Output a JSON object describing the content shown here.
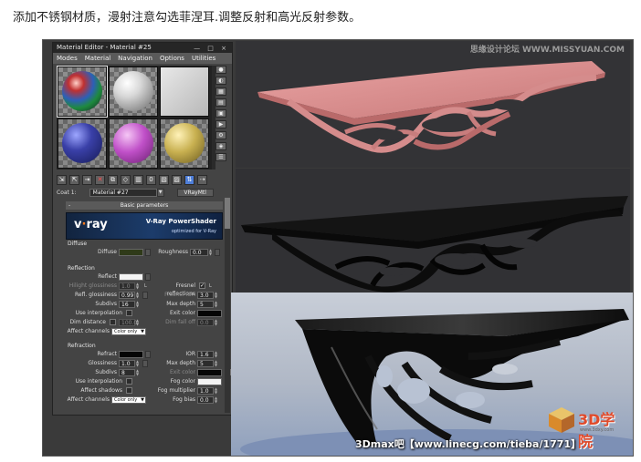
{
  "heading": "添加不锈钢材质，漫射注意勾选菲涅耳.调整反射和高光反射参数。",
  "material_editor": {
    "title": "Material Editor - Material #25",
    "window_controls": "— □ ×",
    "menu": [
      "Modes",
      "Material",
      "Navigation",
      "Options",
      "Utilities"
    ],
    "slot_count": 6,
    "coat_label": "Coat 1:",
    "material_name": "Material #27",
    "material_type": "VRayMtl",
    "rollout_title": "Basic parameters",
    "rollout_sign": "-"
  },
  "vray_banner": {
    "logo": "v·ray",
    "product": "V-Ray PowerShader",
    "tagline": "optimized for V-Ray"
  },
  "diffuse": {
    "section": "Diffuse",
    "diffuse_label": "Diffuse",
    "roughness_label": "Roughness",
    "roughness_value": "0.0"
  },
  "reflection": {
    "section": "Reflection",
    "reflect_label": "Reflect",
    "hilight_label": "Hilight glossiness",
    "hilight_value": "1.0",
    "lock": "L",
    "fresnel_label": "Fresnel reflections",
    "fresnel_checked": "✓",
    "refl_gloss_label": "Refl. glossiness",
    "refl_gloss_value": "0.99",
    "fresnel_ior_label": "Fresnel IOR",
    "fresnel_ior_value": "3.0",
    "subdivs_label": "Subdivs",
    "subdivs_value": "16",
    "max_depth_label": "Max depth",
    "max_depth_value": "5",
    "use_interp_label": "Use interpolation",
    "exit_color_label": "Exit color",
    "dim_distance_label": "Dim distance",
    "dim_distance_value": "100.0",
    "dim_falloff_label": "Dim fall off",
    "dim_falloff_value": "0.0",
    "affect_channels_label": "Affect channels",
    "affect_channels_value": "Color only"
  },
  "refraction": {
    "section": "Refraction",
    "refract_label": "Refract",
    "ior_label": "IOR",
    "ior_value": "1.6",
    "gloss_label": "Glossiness",
    "gloss_value": "1.0",
    "max_depth_label": "Max depth",
    "max_depth_value": "5",
    "subdivs_label": "Subdivs",
    "subdivs_value": "8",
    "exit_color_label": "Exit color",
    "use_interp_label": "Use interpolation",
    "fog_color_label": "Fog color",
    "affect_shadows_label": "Affect shadows",
    "fog_mult_label": "Fog multiplier",
    "fog_mult_value": "1.0",
    "affect_channels_label": "Affect channels",
    "affect_channels_value": "Color only",
    "fog_bias_label": "Fog bias",
    "fog_bias_value": "0.0"
  },
  "watermarks": {
    "top": "思缘设计论坛 WWW.MISSYUAN.COM",
    "bottom": "3Dmax吧【www.linecg.com/tieba/1771】",
    "logo_text": "3D学院",
    "logo_sub": "www.3dxy.com"
  },
  "colors": {
    "pink_render": "#d88888",
    "dark_render": "#0c0c0c",
    "accent_blue": "#4f7fd9"
  }
}
